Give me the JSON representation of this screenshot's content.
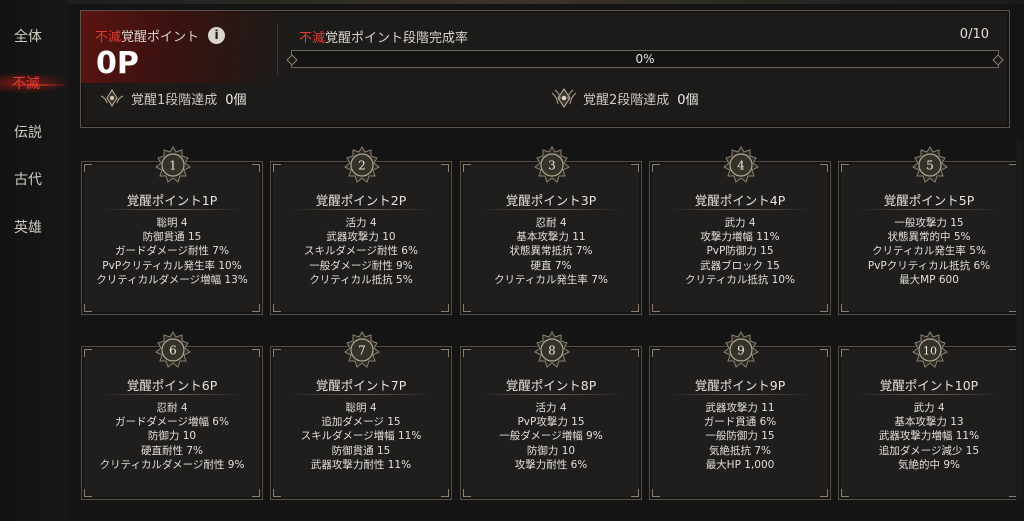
{
  "sidebar": {
    "items": [
      {
        "label": "全体",
        "active": false
      },
      {
        "label": "不滅",
        "active": true
      },
      {
        "label": "伝説",
        "active": false
      },
      {
        "label": "古代",
        "active": false
      },
      {
        "label": "英雄",
        "active": false
      }
    ]
  },
  "summary": {
    "points_prefix": "不滅",
    "points_suffix": "覚醒ポイント",
    "info_icon": "i",
    "points_value": "0P",
    "progress_prefix": "不滅",
    "progress_suffix": "覚醒ポイント段階完成率",
    "progress_count": "0/10",
    "progress_percent_text": "0%",
    "progress_fraction": 0,
    "stage1_label": "覚醒1段階達成",
    "stage1_count": "0個",
    "stage2_label": "覚醒2段階達成",
    "stage2_count": "0個"
  },
  "cards": [
    {
      "number": "1",
      "title": "覚醒ポイント1P",
      "stats": [
        "聡明 4",
        "防御貫通 15",
        "ガードダメージ耐性 7%",
        "PvPクリティカル発生率 10%",
        "クリティカルダメージ増幅 13%"
      ]
    },
    {
      "number": "2",
      "title": "覚醒ポイント2P",
      "stats": [
        "活力 4",
        "武器攻撃力 10",
        "スキルダメージ耐性 6%",
        "一般ダメージ耐性 9%",
        "クリティカル抵抗 5%"
      ]
    },
    {
      "number": "3",
      "title": "覚醒ポイント3P",
      "stats": [
        "忍耐 4",
        "基本攻撃力 11",
        "状態異常抵抗 7%",
        "硬直 7%",
        "クリティカル発生率 7%"
      ]
    },
    {
      "number": "4",
      "title": "覚醒ポイント4P",
      "stats": [
        "武力 4",
        "攻撃力増幅 11%",
        "PvP防御力 15",
        "武器ブロック 15",
        "クリティカル抵抗 10%"
      ]
    },
    {
      "number": "5",
      "title": "覚醒ポイント5P",
      "stats": [
        "一般攻撃力 15",
        "状態異常的中 5%",
        "クリティカル発生率 5%",
        "PvPクリティカル抵抗 6%",
        "最大MP 600"
      ]
    },
    {
      "number": "6",
      "title": "覚醒ポイント6P",
      "stats": [
        "忍耐 4",
        "ガードダメージ増幅 6%",
        "防御力 10",
        "硬直耐性 7%",
        "クリティカルダメージ耐性 9%"
      ]
    },
    {
      "number": "7",
      "title": "覚醒ポイント7P",
      "stats": [
        "聡明 4",
        "追加ダメージ 15",
        "スキルダメージ増幅 11%",
        "防御貫通 15",
        "武器攻撃力耐性 11%"
      ]
    },
    {
      "number": "8",
      "title": "覚醒ポイント8P",
      "stats": [
        "活力 4",
        "PvP攻撃力 15",
        "一般ダメージ増幅 9%",
        "防御力 10",
        "攻撃力耐性 6%"
      ]
    },
    {
      "number": "9",
      "title": "覚醒ポイント9P",
      "stats": [
        "武器攻撃力 11",
        "ガード貫通 6%",
        "一般防御力 15",
        "気絶抵抗 7%",
        "最大HP 1,000"
      ]
    },
    {
      "number": "10",
      "title": "覚醒ポイント10P",
      "stats": [
        "武力 4",
        "基本攻撃力 13",
        "武器攻撃力増幅 11%",
        "追加ダメージ減少 15",
        "気絶的中 9%"
      ]
    }
  ]
}
